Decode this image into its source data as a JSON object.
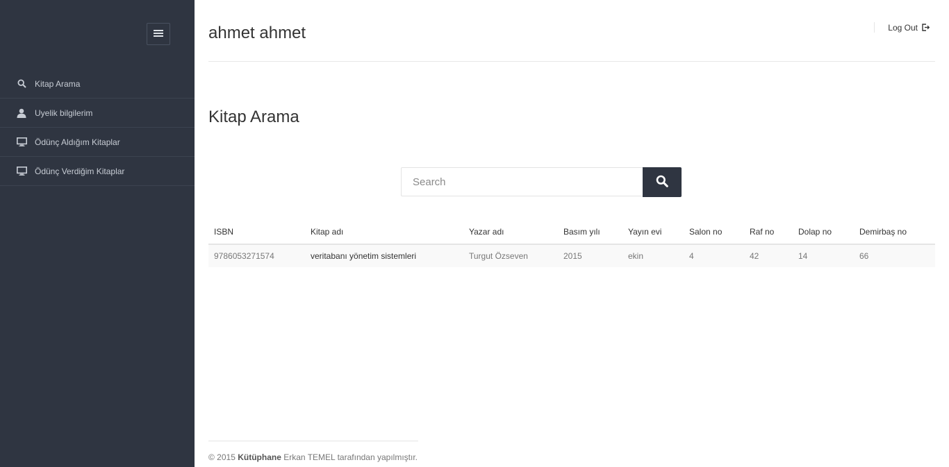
{
  "sidebar": {
    "items": [
      {
        "label": "Kitap Arama",
        "icon": "search-icon"
      },
      {
        "label": "Uyelik bilgilerim",
        "icon": "user-icon"
      },
      {
        "label": "Ödünç Aldığım Kitaplar",
        "icon": "monitor-icon"
      },
      {
        "label": "Ödünç Verdiğim Kitaplar",
        "icon": "monitor-icon"
      }
    ]
  },
  "header": {
    "user_name": "ahmet ahmet",
    "logout_label": "Log Out"
  },
  "main": {
    "page_title": "Kitap Arama",
    "search": {
      "placeholder": "Search",
      "value": ""
    },
    "table": {
      "columns": [
        "ISBN",
        "Kitap adı",
        "Yazar adı",
        "Basım yılı",
        "Yayın evi",
        "Salon no",
        "Raf no",
        "Dolap no",
        "Demirbaş no"
      ],
      "rows": [
        [
          "9786053271574",
          "veritabanı yönetim sistemleri",
          "Turgut Özseven",
          "2015",
          "ekin",
          "4",
          "42",
          "14",
          "66"
        ]
      ]
    }
  },
  "footer": {
    "prefix": "© 2015",
    "brand": "Kütüphane",
    "suffix": "Erkan TEMEL tarafından yapılmıştır."
  },
  "colors": {
    "sidebar_bg": "#2f3541",
    "accent": "#2f3541",
    "row_bg": "#f9f9f9"
  }
}
